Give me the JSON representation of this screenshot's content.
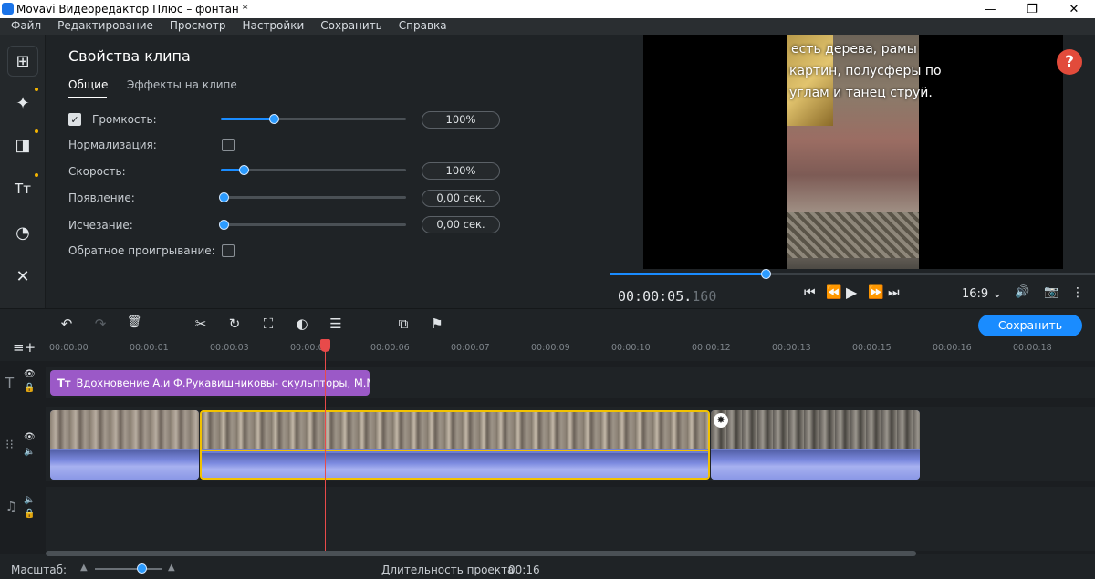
{
  "window": {
    "title": "Movavi Видеоредактор Плюс – фонтан *",
    "minimize": "—",
    "maximize": "❐",
    "close": "✕"
  },
  "menu": [
    "Файл",
    "Редактирование",
    "Просмотр",
    "Настройки",
    "Сохранить",
    "Справка"
  ],
  "left_tools": [
    {
      "icon": "import-icon",
      "glyph": "⊞"
    },
    {
      "icon": "magic-wand-icon",
      "glyph": "✦"
    },
    {
      "icon": "transitions-icon",
      "glyph": "◨"
    },
    {
      "icon": "titles-icon",
      "glyph": "Tт"
    },
    {
      "icon": "stickers-icon",
      "glyph": "◔"
    },
    {
      "icon": "tools-icon",
      "glyph": "✕"
    }
  ],
  "props": {
    "title": "Свойства клипа",
    "tabs": [
      "Общие",
      "Эффекты на клипе"
    ],
    "rows": [
      {
        "label": "Громкость:",
        "value": "100%",
        "level": 0.27
      },
      {
        "label": "Нормализация:"
      },
      {
        "label": "Скорость:",
        "value": "100%",
        "level": 0.11
      },
      {
        "label": "Появление:",
        "value": "0,00 сек.",
        "level": 0.0
      },
      {
        "label": "Исчезание:",
        "value": "0,00 сек.",
        "level": 0.0
      },
      {
        "label": "Обратное проигрывание:"
      }
    ],
    "check_mark": "✓"
  },
  "preview": {
    "overlay_lines": [
      "есть дерева, рамы",
      "картин, полусферы по",
      "углам и танец струй."
    ],
    "help": "?",
    "timecode_main": "00:00:05.",
    "timecode_ms": "160",
    "progress": 0.32,
    "ratio": "16:9 ⌄",
    "controls": [
      "⏮",
      "⏪",
      "▶",
      "⏩",
      "⏭"
    ],
    "right_icons": [
      "🔊",
      "📷",
      "⋮"
    ]
  },
  "toolbar": {
    "tools": [
      {
        "name": "undo-icon",
        "glyph": "↶"
      },
      {
        "name": "redo-icon",
        "glyph": "↷"
      },
      {
        "name": "delete-icon",
        "glyph": "🗑"
      },
      {
        "name": "cut-icon",
        "glyph": "✂"
      },
      {
        "name": "rotate-icon",
        "glyph": "↻"
      },
      {
        "name": "crop-icon",
        "glyph": "⛶"
      },
      {
        "name": "color-icon",
        "glyph": "◐"
      },
      {
        "name": "adjust-icon",
        "glyph": "☰"
      },
      {
        "name": "export-clip-icon",
        "glyph": "⧉"
      },
      {
        "name": "marker-icon",
        "glyph": "⚑"
      }
    ],
    "save_label": "Сохранить"
  },
  "ruler": [
    "00:00:00",
    "00:00:01",
    "00:00:03",
    "00:00:04",
    "00:00:06",
    "00:00:07",
    "00:00:09",
    "00:00:10",
    "00:00:12",
    "00:00:13",
    "00:00:15",
    "00:00:16",
    "00:00:18"
  ],
  "title_clip": {
    "icon": "Tт",
    "text": "Вдохновение А.и Ф.Рукавишниковы- скульпторы, М.Мор"
  },
  "status": {
    "scale_label": "Масштаб:",
    "duration_label": "Длительность проекта:",
    "duration_value": "00:16"
  }
}
